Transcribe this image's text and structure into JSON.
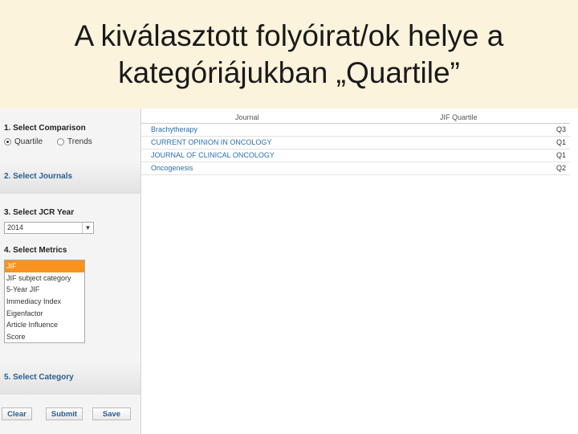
{
  "slide": {
    "title_line1": "A kiválasztott folyóirat/ok helye a",
    "title_line2": "kategóriájukban „Quartile”"
  },
  "sidebar": {
    "select_comparison": "1. Select Comparison",
    "comparison_options": [
      "Quartile",
      "Trends"
    ],
    "comparison_selected": "Quartile",
    "select_journals": "2. Select Journals",
    "select_jcr_year": "3. Select JCR Year",
    "jcr_year_value": "2014",
    "select_metrics": "4. Select Metrics",
    "metrics": [
      "JIF",
      "JIF subject category",
      "5-Year JIF",
      "Immediacy Index",
      "Eigenfactor",
      "Article Influence",
      "Score"
    ],
    "metrics_selected": "JIF",
    "select_category": "5. Select Category",
    "buttons": {
      "clear": "Clear",
      "submit": "Submit",
      "save": "Save"
    }
  },
  "table": {
    "headers": {
      "journal": "Journal",
      "quartile": "JIF Quartile"
    },
    "rows": [
      {
        "journal": "Brachytherapy",
        "quartile": "Q3"
      },
      {
        "journal": "CURRENT OPINION IN ONCOLOGY",
        "quartile": "Q1"
      },
      {
        "journal": "JOURNAL OF CLINICAL ONCOLOGY",
        "quartile": "Q1"
      },
      {
        "journal": "Oncogenesis",
        "quartile": "Q2"
      }
    ]
  },
  "colors": {
    "title_bg": "#fcf3dc",
    "selected_metric": "#f7931e",
    "link_blue": "#2a6fb0"
  }
}
